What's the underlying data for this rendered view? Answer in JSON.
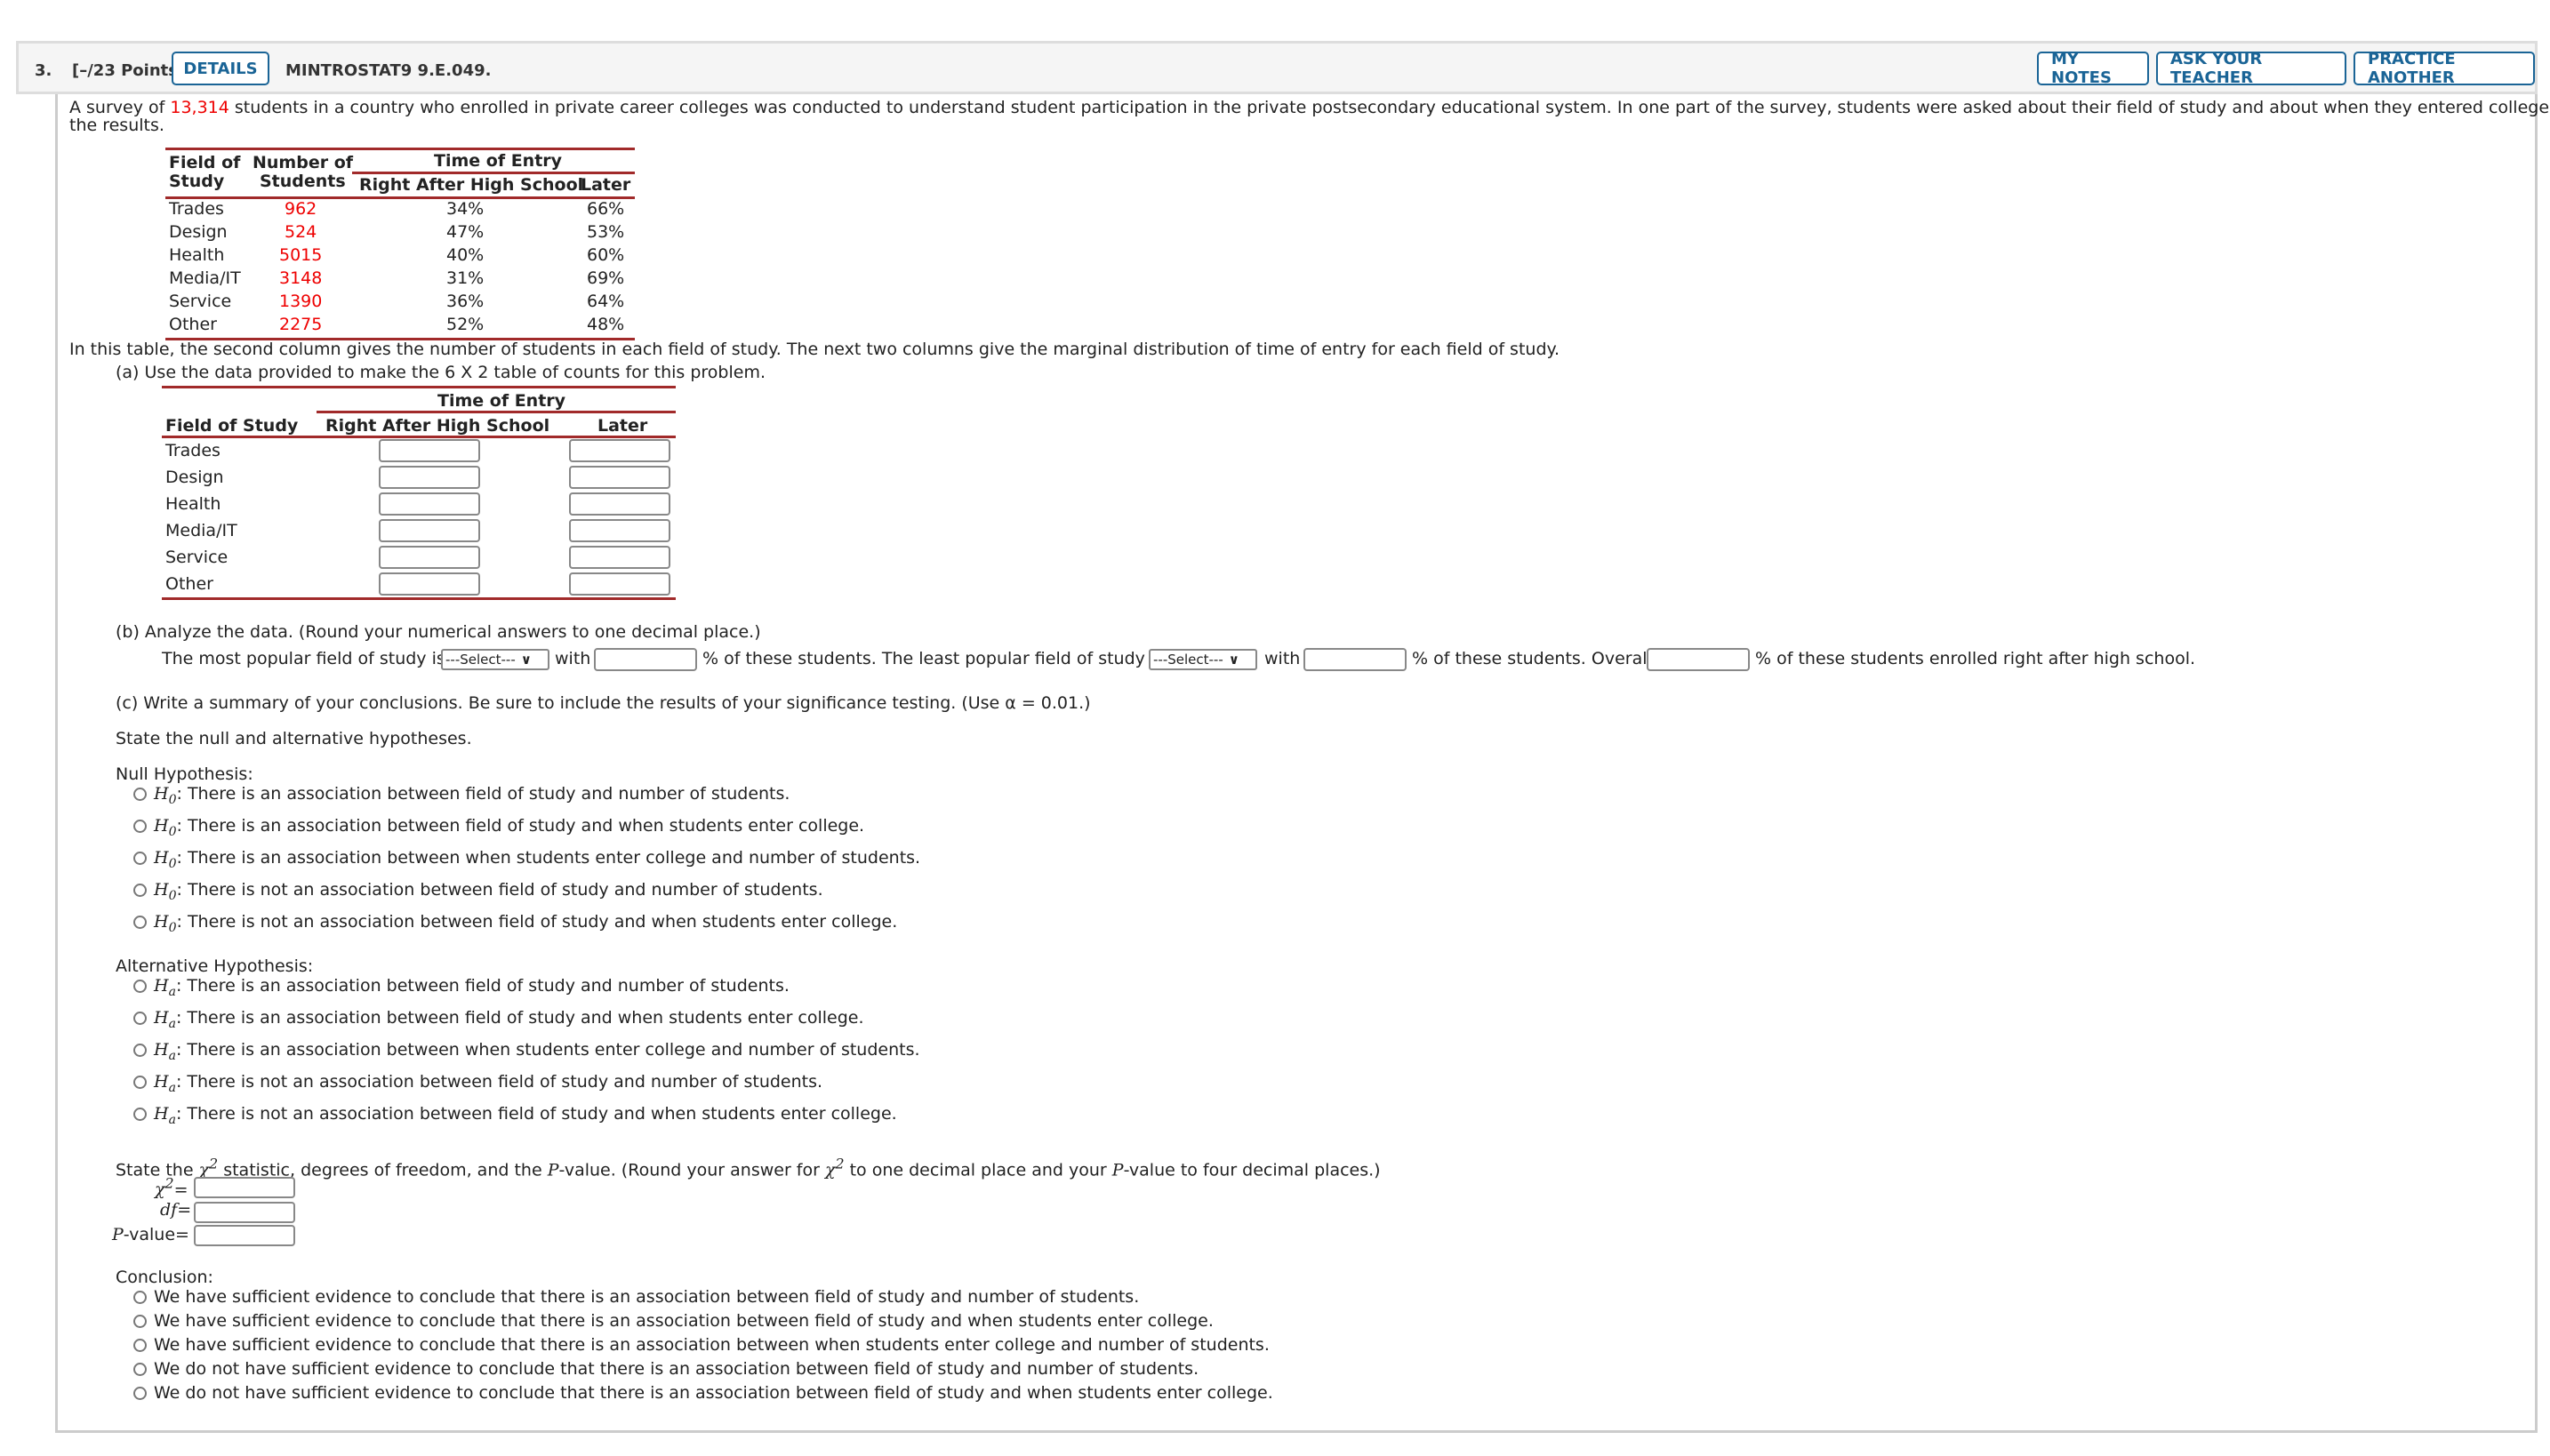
{
  "header": {
    "number": "3.",
    "points": "[–/23 Points]",
    "details_label": "DETAILS",
    "code": "MINTROSTAT9 9.E.049.",
    "my_notes_label": "MY NOTES",
    "ask_teacher_label": "ASK YOUR TEACHER",
    "practice_label": "PRACTICE ANOTHER"
  },
  "intro": {
    "pre": "A survey of ",
    "total": "13,314",
    "post": " students in a country who enrolled in private career colleges was conducted to understand student participation in the private postsecondary educational system. In one part of the survey, students were asked about their field of study and about when they entered college. Here are",
    "line2": "the results."
  },
  "source_table": {
    "headers": {
      "field_1": "Field of",
      "field_2": "Study",
      "num_1": "Number of",
      "num_2": "Students",
      "group": "Time of Entry",
      "right_after": "Right After High School",
      "later": "Later"
    },
    "rows": [
      {
        "field": "Trades",
        "count": "962",
        "right_after": "34%",
        "later": "66%"
      },
      {
        "field": "Design",
        "count": "524",
        "right_after": "47%",
        "later": "53%"
      },
      {
        "field": "Health",
        "count": "5015",
        "right_after": "40%",
        "later": "60%"
      },
      {
        "field": "Media/IT",
        "count": "3148",
        "right_after": "31%",
        "later": "69%"
      },
      {
        "field": "Service",
        "count": "1390",
        "right_after": "36%",
        "later": "64%"
      },
      {
        "field": "Other",
        "count": "2275",
        "right_after": "52%",
        "later": "48%"
      }
    ]
  },
  "table_note": "In this table, the second column gives the number of students in each field of study. The next two columns give the marginal distribution of time of entry for each field of study.",
  "part_a": {
    "prompt": "(a) Use the data provided to make the 6 X 2 table of counts for this problem.",
    "group": "Time of Entry",
    "col_field": "Field of Study",
    "col_right_after": "Right After High School",
    "col_later": "Later",
    "rows": [
      "Trades",
      "Design",
      "Health",
      "Media/IT",
      "Service",
      "Other"
    ]
  },
  "part_b": {
    "prompt": "(b) Analyze the data. (Round your numerical answers to one decimal place.)",
    "s1": "The most popular field of study is",
    "select1": "---Select---",
    "with1": "with",
    "s2": "% of these students. The least popular field of study is",
    "select2": "---Select---",
    "with2": "with",
    "s3": "% of these students. Overall",
    "s4": "% of these students enrolled right after high school."
  },
  "part_c": {
    "prompt": "(c) Write a summary of your conclusions. Be sure to include the results of your significance testing. (Use α = 0.01.)",
    "state_hyp": "State the null and alternative hypotheses.",
    "null_label": "Null Hypothesis:",
    "alt_label": "Alternative Hypothesis:",
    "null_options": [
      "There is an association between field of study and number of students.",
      "There is an association between field of study and when students enter college.",
      "There is an association between when students enter college and number of students.",
      "There is not an association between field of study and number of students.",
      "There is not an association between field of study and when students enter college."
    ],
    "alt_options": [
      "There is an association between field of study and number of students.",
      "There is an association between field of study and when students enter college.",
      "There is an association between when students enter college and number of students.",
      "There is not an association between field of study and number of students.",
      "There is not an association between field of study and when students enter college."
    ],
    "stat_prompt_1": "State the ",
    "stat_prompt_2": " statistic, degrees of freedom, and the ",
    "stat_prompt_3": "-value. (Round your answer for ",
    "stat_prompt_4": " to one decimal place and your ",
    "stat_prompt_5": "-value to four decimal places.)",
    "chi_label": "=",
    "df_label": "df",
    "p_label": "-value",
    "conclusion_label": "Conclusion:",
    "conclusions": [
      "We have sufficient evidence to conclude that there is an association between field of study and number of students.",
      "We have sufficient evidence to conclude that there is an association between field of study and when students enter college.",
      "We have sufficient evidence to conclude that there is an association between when students enter college and number of students.",
      "We do not have sufficient evidence to conclude that there is an association between field of study and number of students.",
      "We do not have sufficient evidence to conclude that there is an association between field of study and when students enter college."
    ]
  }
}
